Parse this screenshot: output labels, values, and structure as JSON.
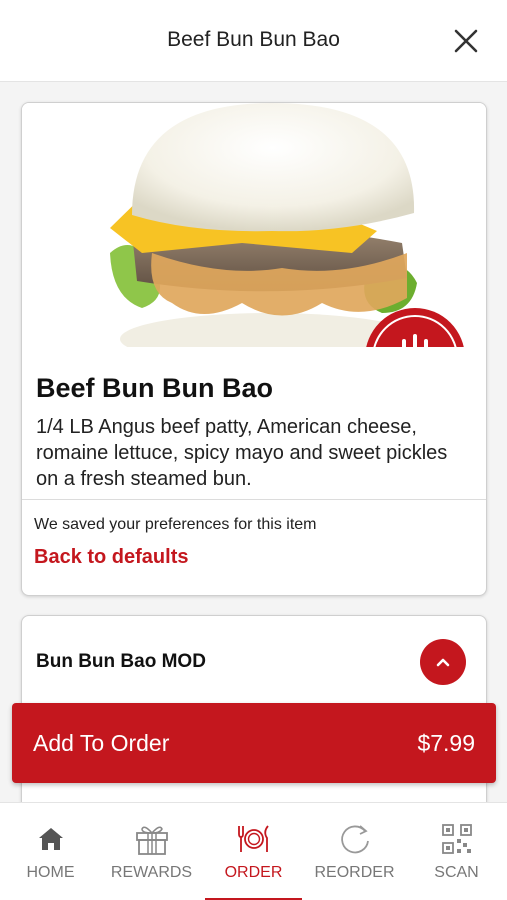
{
  "header": {
    "title": "Beef Bun Bun Bao",
    "close_icon": "close-icon"
  },
  "item": {
    "name": "Beef Bun Bun Bao",
    "description": "1/4 LB Angus beef patty, American cheese, romaine lettuce, spicy mayo and sweet pickles on a fresh steamed bun.",
    "saved_note": "We saved your preferences for this item",
    "defaults_link": "Back to defaults"
  },
  "modifier": {
    "title": "Bun Bun Bao MOD",
    "toggle_icon": "chevron-up-icon"
  },
  "order_bar": {
    "label": "Add To Order",
    "price": "$7.99"
  },
  "nav": {
    "items": [
      {
        "label": "HOME",
        "icon": "home-icon"
      },
      {
        "label": "REWARDS",
        "icon": "gift-icon"
      },
      {
        "label": "ORDER",
        "icon": "plate-utensils-icon",
        "active": true
      },
      {
        "label": "REORDER",
        "icon": "refresh-icon"
      },
      {
        "label": "SCAN",
        "icon": "qr-code-icon"
      }
    ]
  },
  "colors": {
    "accent": "#c4171e",
    "nav_inactive": "#777777"
  }
}
